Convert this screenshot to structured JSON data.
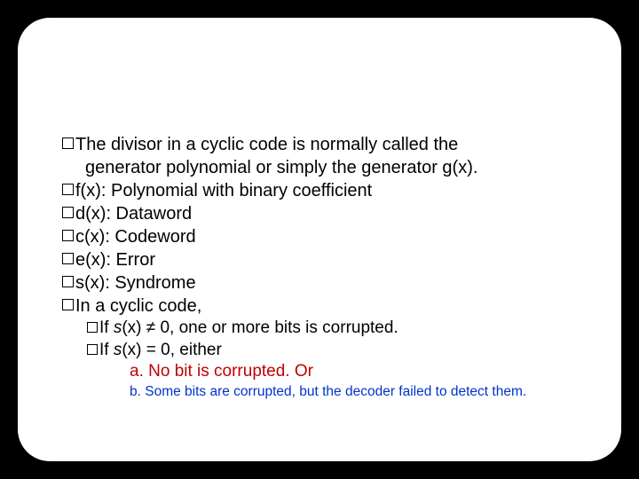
{
  "bullets": {
    "b1a": "The divisor in a cyclic code is normally called the",
    "b1b": "generator polynomial or simply the generator g(x).",
    "b2": "f(x): Polynomial with binary coefficient",
    "b3": "d(x): Dataword",
    "b4": "c(x): Codeword",
    "b5": "e(x): Error",
    "b6": "s(x): Syndrome",
    "b7": "In a cyclic code,"
  },
  "sub": {
    "s1_pre": "If ",
    "s1_var": "s",
    "s1_post": "(x) ≠ 0, one or more bits is corrupted.",
    "s2_pre": "If ",
    "s2_var": "s",
    "s2_post": "(x) = 0, either"
  },
  "subsub": {
    "a": "a. No bit is corrupted. Or",
    "b": "b. Some bits are corrupted, but the decoder failed to detect them."
  }
}
